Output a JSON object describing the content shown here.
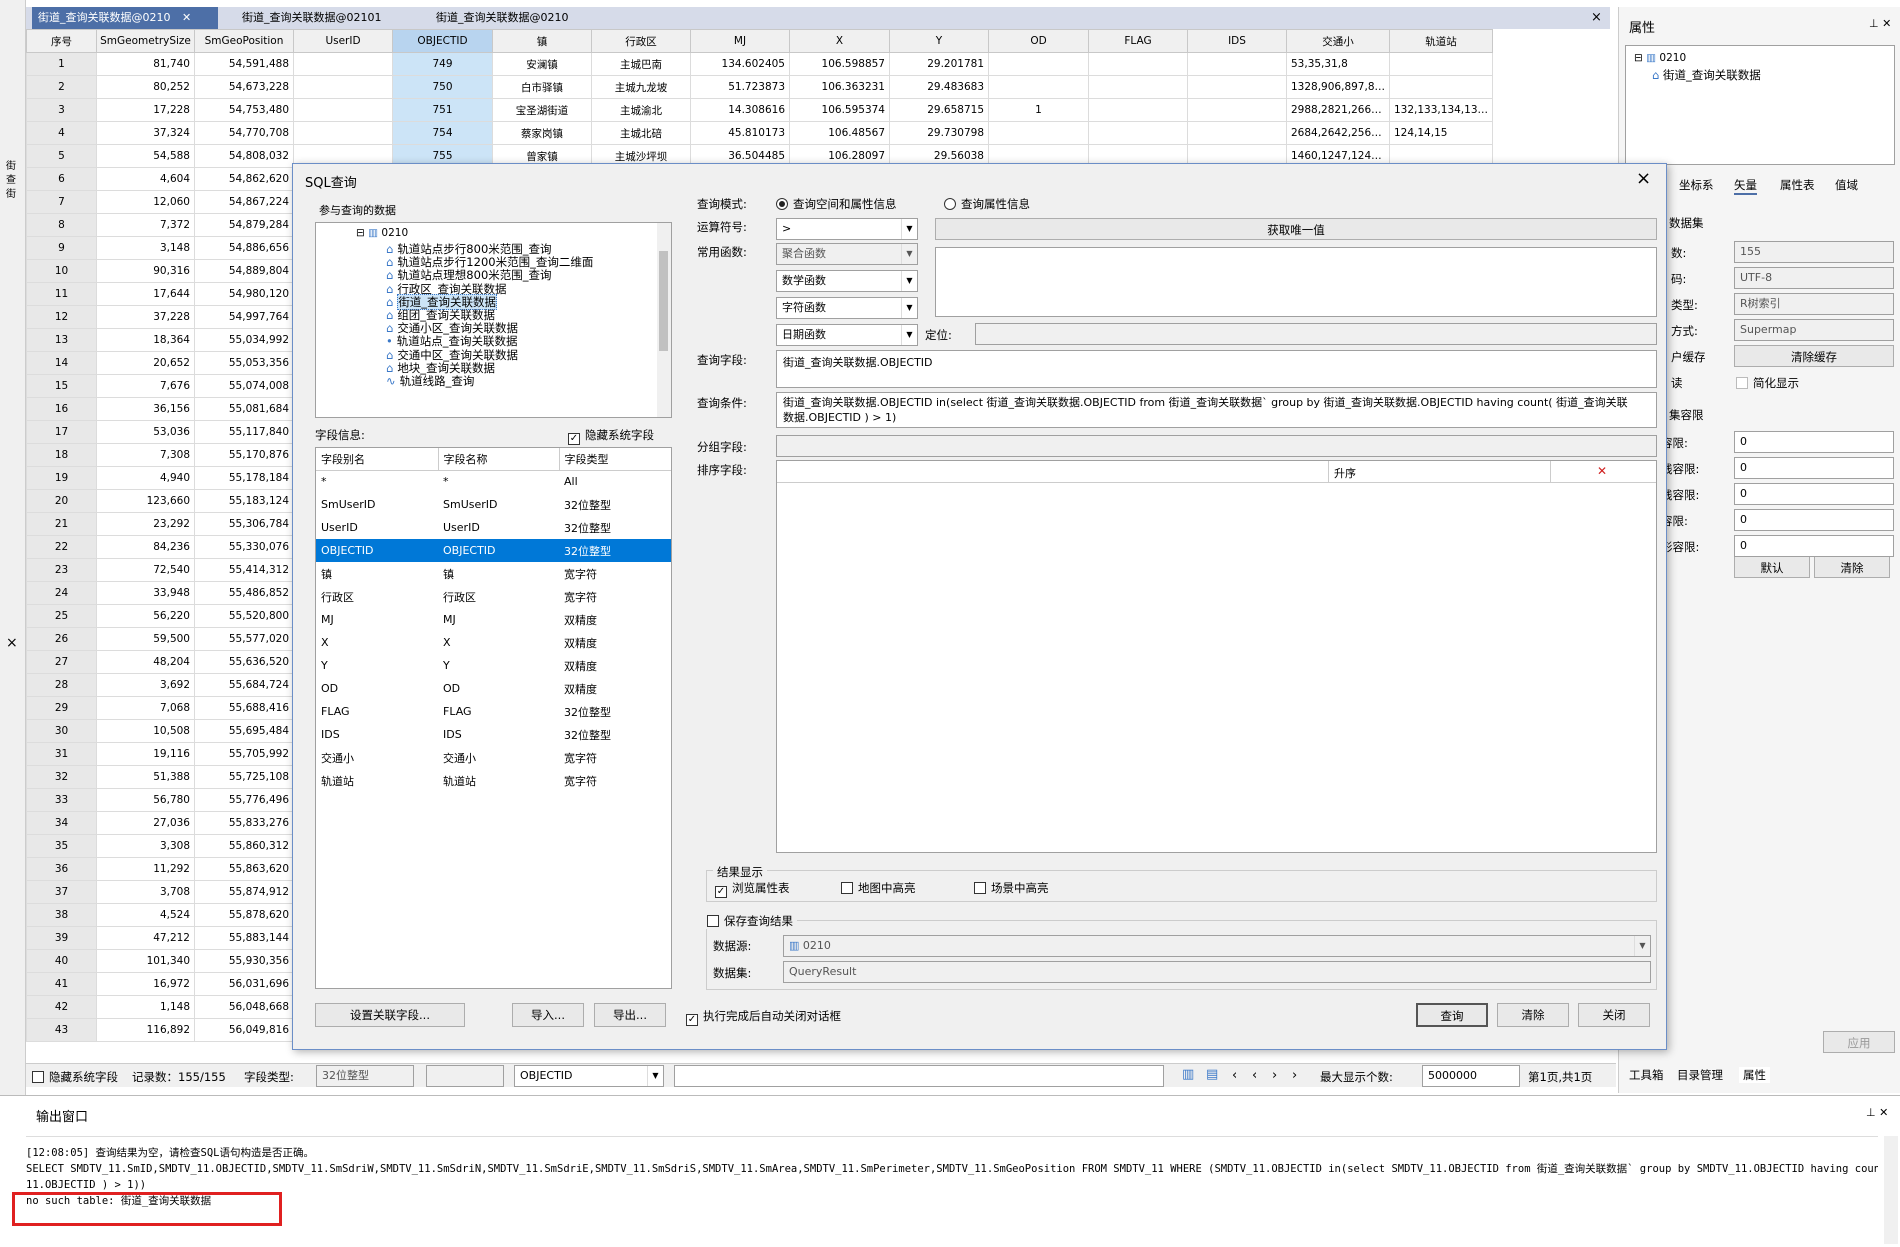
{
  "tabs": [
    "街道_查询关联数据@0210",
    "街道_查询关联数据@02101",
    "街道_查询关联数据@0210"
  ],
  "grid": {
    "headers": [
      "序号",
      "SmGeometrySize",
      "SmGeoPosition",
      "UserID",
      "OBJECTID",
      "镇",
      "行政区",
      "MJ",
      "X",
      "Y",
      "OD",
      "FLAG",
      "IDS",
      "交通小",
      "轨道站"
    ],
    "top_rows": [
      [
        "1",
        "81,740",
        "54,591,488",
        "",
        "749",
        "安澜镇",
        "主城巴南",
        "134.602405",
        "106.598857",
        "29.201781",
        "",
        "",
        "",
        "53,35,31,8",
        ""
      ],
      [
        "2",
        "80,252",
        "54,673,228",
        "",
        "750",
        "白市驿镇",
        "主城九龙坡",
        "51.723873",
        "106.363231",
        "29.483683",
        "",
        "",
        "",
        "1328,906,897,8…",
        ""
      ],
      [
        "3",
        "17,228",
        "54,753,480",
        "",
        "751",
        "宝圣湖街道",
        "主城渝北",
        "14.308616",
        "106.595374",
        "29.658715",
        "1",
        "",
        "",
        "2988,2821,266…",
        "132,133,134,13…"
      ],
      [
        "4",
        "37,324",
        "54,770,708",
        "",
        "754",
        "蔡家岗镇",
        "主城北碚",
        "45.810173",
        "106.48567",
        "29.730798",
        "",
        "",
        "",
        "2684,2642,256…",
        "124,14,15"
      ],
      [
        "5",
        "54,588",
        "54,808,032",
        "",
        "755",
        "曾家镇",
        "主城沙坪坝",
        "36.504485",
        "106.28097",
        "29.56038",
        "",
        "",
        "",
        "1460,1247,124…",
        ""
      ]
    ],
    "rest_rows": [
      [
        "6",
        "4,604",
        "54,862,620"
      ],
      [
        "7",
        "12,060",
        "54,867,224"
      ],
      [
        "8",
        "7,372",
        "54,879,284"
      ],
      [
        "9",
        "3,148",
        "54,886,656"
      ],
      [
        "10",
        "90,316",
        "54,889,804"
      ],
      [
        "11",
        "17,644",
        "54,980,120"
      ],
      [
        "12",
        "37,228",
        "54,997,764"
      ],
      [
        "13",
        "18,364",
        "55,034,992"
      ],
      [
        "14",
        "20,652",
        "55,053,356"
      ],
      [
        "15",
        "7,676",
        "55,074,008"
      ],
      [
        "16",
        "36,156",
        "55,081,684"
      ],
      [
        "17",
        "53,036",
        "55,117,840"
      ],
      [
        "18",
        "7,308",
        "55,170,876"
      ],
      [
        "19",
        "4,940",
        "55,178,184"
      ],
      [
        "20",
        "123,660",
        "55,183,124"
      ],
      [
        "21",
        "23,292",
        "55,306,784"
      ],
      [
        "22",
        "84,236",
        "55,330,076"
      ],
      [
        "23",
        "72,540",
        "55,414,312"
      ],
      [
        "24",
        "33,948",
        "55,486,852"
      ],
      [
        "25",
        "56,220",
        "55,520,800"
      ],
      [
        "26",
        "59,500",
        "55,577,020"
      ],
      [
        "27",
        "48,204",
        "55,636,520"
      ],
      [
        "28",
        "3,692",
        "55,684,724"
      ],
      [
        "29",
        "7,068",
        "55,688,416"
      ],
      [
        "30",
        "10,508",
        "55,695,484"
      ],
      [
        "31",
        "19,116",
        "55,705,992"
      ],
      [
        "32",
        "51,388",
        "55,725,108"
      ],
      [
        "33",
        "56,780",
        "55,776,496"
      ],
      [
        "34",
        "27,036",
        "55,833,276"
      ],
      [
        "35",
        "3,308",
        "55,860,312"
      ],
      [
        "36",
        "11,292",
        "55,863,620"
      ],
      [
        "37",
        "3,708",
        "55,874,912"
      ],
      [
        "38",
        "4,524",
        "55,878,620"
      ],
      [
        "39",
        "47,212",
        "55,883,144"
      ],
      [
        "40",
        "101,340",
        "55,930,356"
      ],
      [
        "41",
        "16,972",
        "56,031,696"
      ],
      [
        "42",
        "1,148",
        "56,048,668"
      ],
      [
        "43",
        "116,892",
        "56,049,816"
      ]
    ]
  },
  "status": {
    "hide_sys": "隐藏系统字段",
    "records": "记录数：155/155",
    "field_type_label": "字段类型:",
    "field_type": "32位整型",
    "field_select": "OBJECTID",
    "max_label": "最大显示个数:",
    "max_value": "5000000",
    "page": "第1页,共1页"
  },
  "right": {
    "title": "属性",
    "tree_root": "0210",
    "tree_child": "街道_查询关联数据",
    "tabs": [
      "坐标系",
      "矢量",
      "属性表",
      "值域"
    ],
    "section1": "数据集",
    "rows1": [
      {
        "label": "数:",
        "value": "155"
      },
      {
        "label": "码:",
        "value": "UTF-8"
      },
      {
        "label": "类型:",
        "value": "R树索引"
      },
      {
        "label": "方式:",
        "value": "Supermap"
      },
      {
        "label": "户缓存",
        "value": "清除缓存"
      }
    ],
    "simplify": "简化显示",
    "readonly": "读",
    "section2": "集容限",
    "rows2": [
      {
        "label": "容限:",
        "value": "0"
      },
      {
        "label": "线容限:",
        "value": "0"
      },
      {
        "label": "线容限:",
        "value": "0"
      },
      {
        "label": "容限:",
        "value": "0"
      },
      {
        "label": "形容限:",
        "value": "0"
      }
    ],
    "btn_default": "默认",
    "btn_clear": "清除",
    "btn_apply": "应用",
    "bottom_tabs": [
      "工具箱",
      "目录管理",
      "属性"
    ]
  },
  "output": {
    "title": "输出窗口",
    "line1": "[12:08:05] 查询结果为空，请检查SQL语句构造是否正确。",
    "line2": "SELECT SMDTV_11.SmID,SMDTV_11.OBJECTID,SMDTV_11.SmSdriW,SMDTV_11.SmSdriN,SMDTV_11.SmSdriE,SMDTV_11.SmSdriS,SMDTV_11.SmArea,SMDTV_11.SmPerimeter,SMDTV_11.SmGeoPosition  FROM SMDTV_11 WHERE (SMDTV_11.OBJECTID in(select SMDTV_11.OBJECTID from 街道_查询关联数据` group by SMDTV_11.OBJECTID having count( SMDTV_",
    "line3": "11.OBJECTID ) > 1))",
    "line4": "no such table: 街道_查询关联数据"
  },
  "dialog": {
    "title": "SQL查询",
    "close": "×",
    "datasets_label": "参与查询的数据",
    "tree_root": "0210",
    "tree_items": [
      "轨道站点步行800米范围_查询",
      "轨道站点步行1200米范围_查询二维面",
      "轨道站点理想800米范围_查询",
      "行政区_查询关联数据",
      "街道_查询关联数据",
      "组团_查询关联数据",
      "交通小区_查询关联数据",
      "轨道站点_查询关联数据",
      "交通中区_查询关联数据",
      "地块_查询关联数据",
      "轨道线路_查询"
    ],
    "field_info_label": "字段信息:",
    "hide_sys_fields": "隐藏系统字段",
    "field_headers": [
      "字段别名",
      "字段名称",
      "字段类型"
    ],
    "fields": [
      [
        "*",
        "*",
        "All"
      ],
      [
        "SmUserID",
        "SmUserID",
        "32位整型"
      ],
      [
        "UserID",
        "UserID",
        "32位整型"
      ],
      [
        "OBJECTID",
        "OBJECTID",
        "32位整型"
      ],
      [
        "镇",
        "镇",
        "宽字符"
      ],
      [
        "行政区",
        "行政区",
        "宽字符"
      ],
      [
        "MJ",
        "MJ",
        "双精度"
      ],
      [
        "X",
        "X",
        "双精度"
      ],
      [
        "Y",
        "Y",
        "双精度"
      ],
      [
        "OD",
        "OD",
        "双精度"
      ],
      [
        "FLAG",
        "FLAG",
        "32位整型"
      ],
      [
        "IDS",
        "IDS",
        "32位整型"
      ],
      [
        "交通小",
        "交通小",
        "宽字符"
      ],
      [
        "轨道站",
        "轨道站",
        "宽字符"
      ]
    ],
    "query_mode_label": "查询模式:",
    "mode_spatial": "查询空间和属性信息",
    "mode_attr": "查询属性信息",
    "operator_label": "运算符号:",
    "operator_value": ">",
    "unique_btn": "获取唯一值",
    "func_label": "常用函数:",
    "func_agg": "聚合函数",
    "func_math": "数学函数",
    "func_str": "字符函数",
    "func_date": "日期函数",
    "locate_label": "定位:",
    "query_field_label": "查询字段:",
    "query_field_value": "街道_查询关联数据.OBJECTID",
    "query_cond_label": "查询条件:",
    "query_cond_value": "街道_查询关联数据.OBJECTID in(select 街道_查询关联数据.OBJECTID from 街道_查询关联数据` group by 街道_查询关联数据.OBJECTID having count( 街道_查询关联数据.OBJECTID ) > 1)",
    "group_label": "分组字段:",
    "sort_label": "排序字段:",
    "sort_order": "升序",
    "sort_delete": "✕",
    "result_label": "结果显示",
    "browse": "浏览属性表",
    "map_highlight": "地图中高亮",
    "scene_highlight": "场景中高亮",
    "save_result": "保存查询结果",
    "datasource_label": "数据源:",
    "datasource_value": "0210",
    "dataset_label": "数据集:",
    "dataset_value": "QueryResult",
    "btn_relation": "设置关联字段...",
    "btn_import": "导入...",
    "btn_export": "导出...",
    "auto_close": "执行完成后自动关闭对话框",
    "btn_query": "查询",
    "btn_clear": "清除",
    "btn_close": "关闭"
  },
  "colors": {
    "selection": "#0078d7",
    "tab_active": "#4d6fa7",
    "error_box": "#e02020"
  }
}
